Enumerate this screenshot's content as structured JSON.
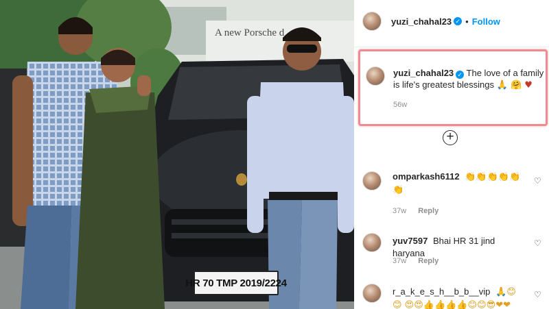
{
  "photo": {
    "banner_text": "A new Porsche d",
    "plate_text": "HR 70 TMP 2019/2224"
  },
  "header": {
    "username": "yuzi_chahal23",
    "separator": "•",
    "follow_label": "Follow"
  },
  "caption": {
    "username": "yuzi_chahal23",
    "text": "The love of a family is life's greatest blessings",
    "emojis": "🙏 🤗 ♥",
    "time": "56w"
  },
  "more_comments_icon": "+",
  "comments": [
    {
      "user": "omparkash6112",
      "text": "👏👏👏👏👏 👏",
      "time": "37w",
      "reply_label": "Reply"
    },
    {
      "user": "yuv7597",
      "text": "Bhai HR 31 jind haryana",
      "time": "37w",
      "reply_label": "Reply"
    },
    {
      "user": "r_a_k_e_s_h__b_b__vip",
      "text": "🙏😊😊 😍😍👍👍👍👍😊😊😎❤❤",
      "time": "",
      "reply_label": ""
    }
  ],
  "icons": {
    "verified": "verified-badge-icon",
    "heart": "heart-outline-icon",
    "more": "plus-circle-icon"
  },
  "colors": {
    "accent": "#0095f6",
    "highlight_border": "#f08a92"
  }
}
